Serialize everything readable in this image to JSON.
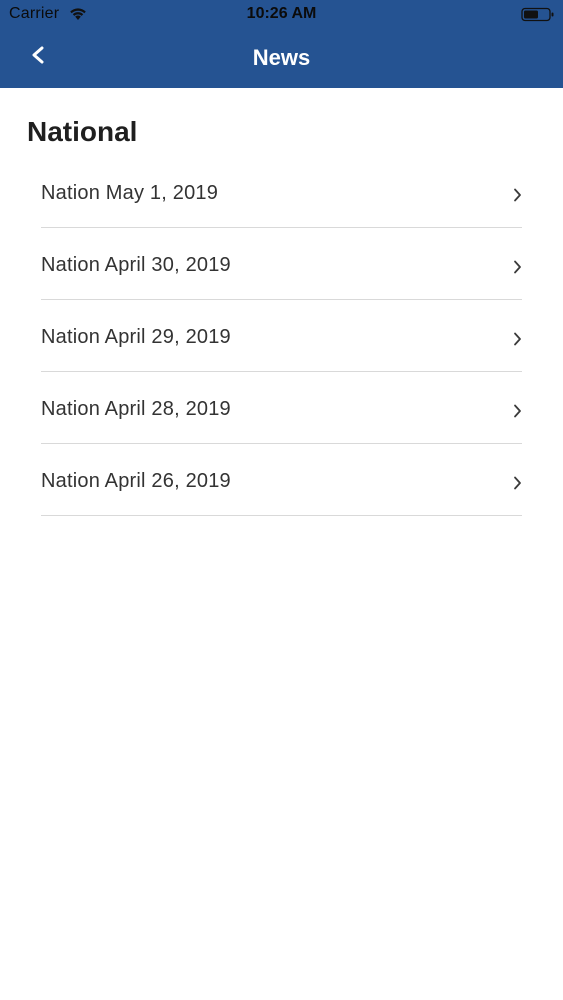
{
  "status_bar": {
    "carrier": "Carrier",
    "time": "10:26 AM",
    "icons": [
      "wifi-icon",
      "battery-icon"
    ]
  },
  "navbar": {
    "title": "News",
    "back_label": "<",
    "background_color": "#255392",
    "title_color": "#ffffff"
  },
  "section": {
    "title": "National"
  },
  "items": [
    {
      "label": "Nation May 1, 2019"
    },
    {
      "label": "Nation April 30, 2019"
    },
    {
      "label": "Nation April 29, 2019"
    },
    {
      "label": "Nation April 28, 2019"
    },
    {
      "label": "Nation April 26, 2019"
    }
  ]
}
